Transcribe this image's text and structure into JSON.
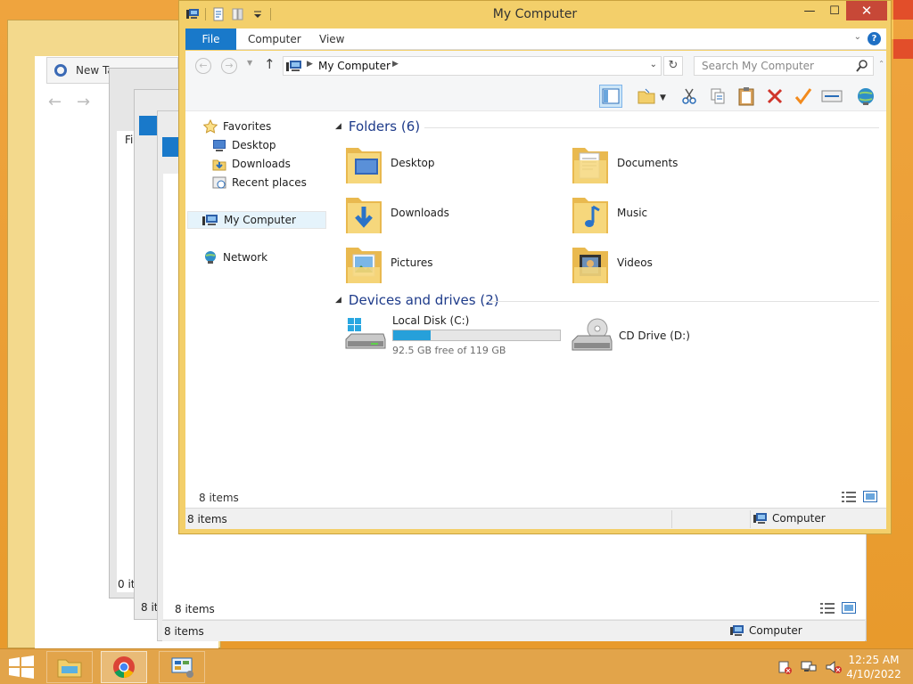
{
  "window": {
    "title": "My Computer",
    "minimize": "—",
    "maximize": "☐",
    "close": "✕"
  },
  "ribbon": {
    "tabs": [
      {
        "label": "File"
      },
      {
        "label": "Computer"
      },
      {
        "label": "View"
      }
    ],
    "help": "?"
  },
  "navbar": {
    "address": "My Computer",
    "search_placeholder": "Search My Computer"
  },
  "navpane": {
    "favorites": "Favorites",
    "desktop": "Desktop",
    "downloads": "Downloads",
    "recent": "Recent places",
    "computer": "My Computer",
    "network": "Network"
  },
  "folders": {
    "header": "Folders (6)",
    "items": [
      {
        "label": "Desktop",
        "icon": "desktop-folder-icon"
      },
      {
        "label": "Documents",
        "icon": "documents-folder-icon"
      },
      {
        "label": "Downloads",
        "icon": "downloads-folder-icon"
      },
      {
        "label": "Music",
        "icon": "music-folder-icon"
      },
      {
        "label": "Pictures",
        "icon": "pictures-folder-icon"
      },
      {
        "label": "Videos",
        "icon": "videos-folder-icon"
      }
    ]
  },
  "devices": {
    "header": "Devices and drives (2)",
    "local_disk": {
      "label": "Local Disk (C:)",
      "free": "92.5 GB free of 119 GB",
      "used_fraction": 0.223
    },
    "cd_drive": {
      "label": "CD Drive (D:)"
    }
  },
  "status": {
    "inner_count": "8 items",
    "bar_count": "8 items",
    "bar_location": "Computer"
  },
  "background_window": {
    "tab_title": "New Ta",
    "menu_fragment": "Fi",
    "status_a": "0 it",
    "status_b": "8 it",
    "inner_count": "8 items",
    "bar_count": "8 items",
    "bar_location": "Computer"
  },
  "taskbar": {
    "time": "12:25 AM",
    "date": "4/10/2022"
  },
  "colors": {
    "accent": "#1979ca",
    "window_frame": "#f3cf6a",
    "progress": "#26a0da",
    "close": "#c74837"
  }
}
